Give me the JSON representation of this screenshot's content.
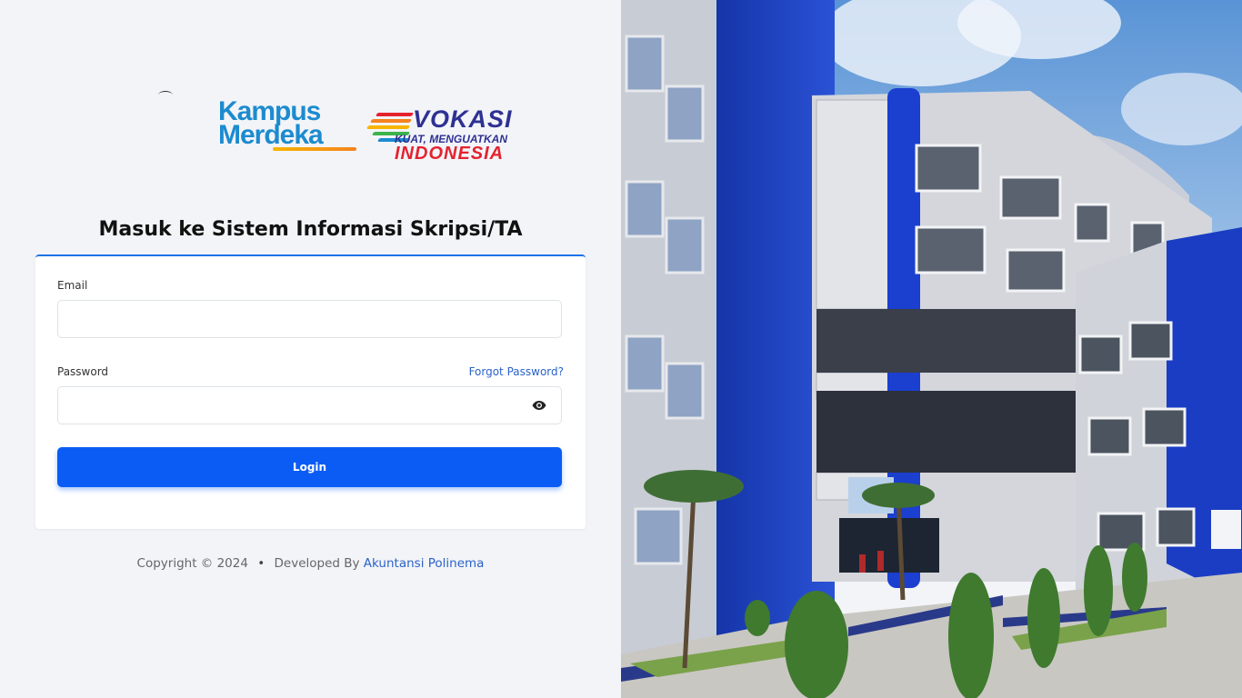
{
  "logos": {
    "kampus_merdeka_line1": "Kampus",
    "kampus_merdeka_line2": "Merdeka",
    "vokasi_title": "VOKASI",
    "vokasi_line1": "KUAT, MENGUATKAN",
    "vokasi_line2": "INDONESIA"
  },
  "page": {
    "title": "Masuk ke Sistem Informasi Skripsi/TA"
  },
  "form": {
    "email_label": "Email",
    "email_value": "",
    "password_label": "Password",
    "password_value": "",
    "forgot_label": "Forgot Password?",
    "login_label": "Login"
  },
  "footer": {
    "copyright": "Copyright © 2024",
    "separator": "•",
    "developed_by": "Developed By",
    "developer": "Akuntansi Polinema"
  },
  "colors": {
    "primary": "#0a5cf5",
    "link": "#2a63c9",
    "background": "#f3f4f8",
    "building_blue": "#1f3fbf"
  },
  "icons": {
    "password_toggle": "eye-icon"
  }
}
